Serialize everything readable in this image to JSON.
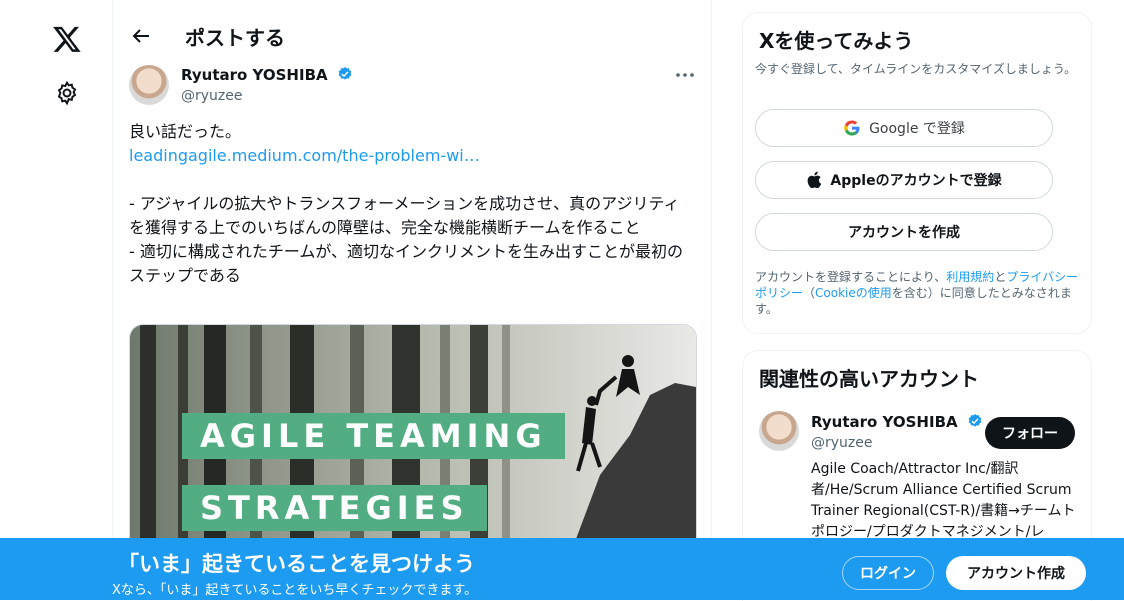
{
  "header": {
    "title": "ポストする"
  },
  "post": {
    "author_name": "Ryutaro YOSHIBA",
    "author_handle": "@ryuzee",
    "text_line1": "良い話だった。",
    "link": "leadingagile.medium.com/the-problem-wi…",
    "bullet1": "- アジャイルの拡大やトランスフォーメーションを成功させ、真のアジリティを獲得する上でのいちばんの障壁は、完全な機能横断チームを作ること",
    "bullet2": "- 適切に構成されたチームが、適切なインクリメントを生み出すことが最初のステップである",
    "image_title_line1": "AGILE TEAMING",
    "image_title_line2": "STRATEGIES"
  },
  "signup": {
    "title": "Xを使ってみよう",
    "subtitle": "今すぐ登録して、タイムラインをカスタマイズしましょう。",
    "google_label": "Google で登録",
    "apple_label": "Appleのアカウントで登録",
    "create_label": "アカウントを作成",
    "terms_prefix": "アカウントを登録することにより、",
    "terms_link": "利用規約",
    "terms_and": "と",
    "privacy_link": "プライバシーポリシー",
    "terms_paren_open": "（",
    "cookie_link": "Cookieの使用",
    "terms_suffix": "を含む）に同意したとみなされます。"
  },
  "related": {
    "title": "関連性の高いアカウント",
    "name": "Ryutaro YOSHIBA",
    "handle": "@ryuzee",
    "follow_label": "フォロー",
    "bio": "Agile Coach/Attractor Inc/翻訳者/He/Scrum Alliance Certified Scrum Trainer Regional(CST-R)/書籍→チームトポロジー/プロダクトマネジメント/レ"
  },
  "banner": {
    "title": "「いま」起きていることを見つけよう",
    "subtitle": "Xなら、「いま」起きていることをいち早くチェックできます。",
    "login_label": "ログイン",
    "signup_label": "アカウント作成"
  },
  "colors": {
    "accent": "#1d9bf0",
    "text": "#0f1419",
    "muted": "#536471",
    "image_label_bg": "#52ad82"
  },
  "icons": [
    "x-logo-icon",
    "gear-icon",
    "back-arrow-icon",
    "verified-badge-icon",
    "more-icon",
    "google-icon",
    "apple-icon"
  ]
}
